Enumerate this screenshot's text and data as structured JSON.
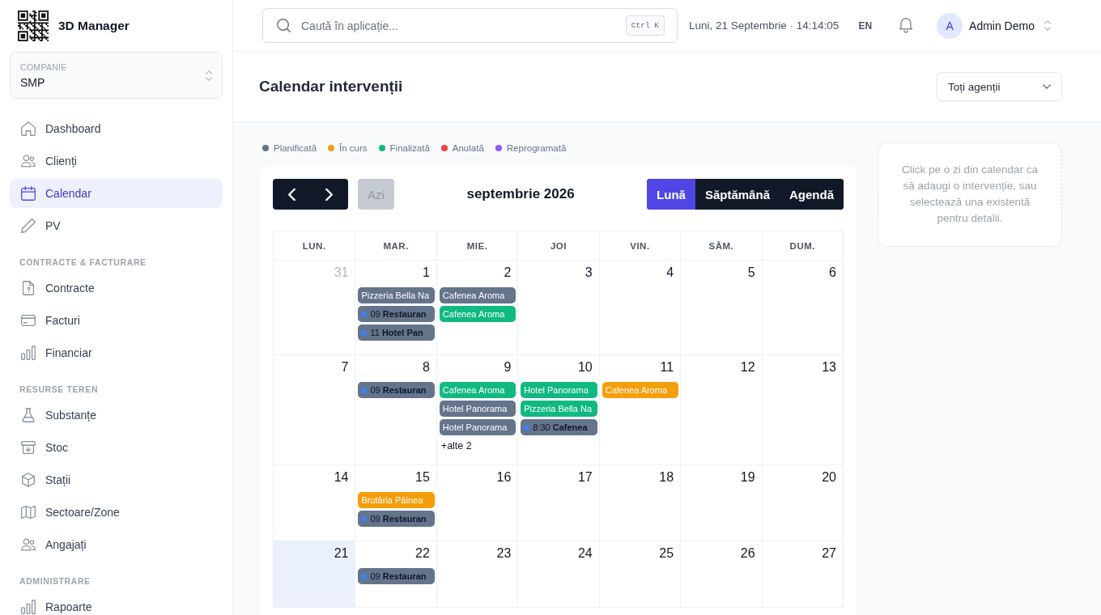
{
  "sidebar": {
    "brand": "3D Manager",
    "company": {
      "label": "COMPANIE",
      "value": "SMP"
    },
    "sections": [
      {
        "items": [
          {
            "label": "Dashboard",
            "selected": false
          },
          {
            "label": "Clienți",
            "selected": false
          },
          {
            "label": "Calendar",
            "selected": true
          },
          {
            "label": "PV",
            "selected": false
          }
        ]
      },
      {
        "heading": "CONTRACTE & FACTURARE",
        "items": [
          {
            "label": "Contracte",
            "selected": false
          },
          {
            "label": "Facturi",
            "selected": false
          },
          {
            "label": "Financiar",
            "selected": false
          }
        ]
      },
      {
        "heading": "RESURSE TEREN",
        "items": [
          {
            "label": "Substanțe",
            "selected": false
          },
          {
            "label": "Stoc",
            "selected": false
          },
          {
            "label": "Stații",
            "selected": false
          },
          {
            "label": "Sectoare/Zone",
            "selected": false
          },
          {
            "label": "Angajați",
            "selected": false
          }
        ]
      },
      {
        "heading": "ADMINISTRARE",
        "items": [
          {
            "label": "Rapoarte",
            "selected": false
          }
        ]
      }
    ]
  },
  "topbar": {
    "search": {
      "placeholder": "Caută în aplicație...",
      "shortcut": "Ctrl K"
    },
    "datetime": "Luni, 21 Septembrie · 14:14:05",
    "language": "EN",
    "user": {
      "initial": "A",
      "name": "Admin Demo"
    }
  },
  "page": {
    "title": "Calendar intervenții",
    "agent_filter": {
      "value": "Toți agenții"
    }
  },
  "legend": [
    {
      "label": "Planificată",
      "color": "#64748b"
    },
    {
      "label": "În curs",
      "color": "#f59e0b"
    },
    {
      "label": "Finalizată",
      "color": "#10b981"
    },
    {
      "label": "Anulată",
      "color": "#ef4444"
    },
    {
      "label": "Reprogramată",
      "color": "#8b5cf6"
    }
  ],
  "calendar": {
    "today_button": {
      "label": "Azi",
      "disabled": true
    },
    "title": "septembrie 2026",
    "views": [
      {
        "label": "Lună",
        "selected": true
      },
      {
        "label": "Săptămână",
        "selected": false
      },
      {
        "label": "Agendă",
        "selected": false
      }
    ],
    "weekdays": [
      "LUN.",
      "MAR.",
      "MIE.",
      "JOI",
      "VIN.",
      "SÂM.",
      "DUM."
    ],
    "weeks": [
      {
        "days": [
          {
            "day": "31",
            "outside": true,
            "today": false
          },
          {
            "day": "1",
            "outside": false,
            "today": false,
            "events": [
              {
                "kind": "allday",
                "label": "Pizzeria Bella Na",
                "color": "#64748b"
              },
              {
                "kind": "timed",
                "label": "09 **Restauran**",
                "color": "#64748b"
              },
              {
                "kind": "timed",
                "label": "11 **Hotel Pan**",
                "color": "#64748b"
              }
            ]
          },
          {
            "day": "2",
            "outside": false,
            "today": false,
            "events": [
              {
                "kind": "allday",
                "label": "Cafenea Aroma",
                "color": "#64748b"
              },
              {
                "kind": "allday",
                "label": "Cafenea Aroma",
                "color": "#10b981"
              }
            ]
          },
          {
            "day": "3",
            "outside": false,
            "today": false
          },
          {
            "day": "4",
            "outside": false,
            "today": false
          },
          {
            "day": "5",
            "outside": false,
            "today": false
          },
          {
            "day": "6",
            "outside": false,
            "today": false
          }
        ]
      },
      {
        "days": [
          {
            "day": "7",
            "outside": false,
            "today": false
          },
          {
            "day": "8",
            "outside": false,
            "today": false,
            "events": [
              {
                "kind": "timed",
                "label": "09 **Restauran**",
                "color": "#64748b"
              }
            ]
          },
          {
            "day": "9",
            "outside": false,
            "today": false,
            "events": [
              {
                "kind": "allday",
                "label": "Cafenea Aroma",
                "color": "#10b981"
              },
              {
                "kind": "allday",
                "label": "Hotel Panorama",
                "color": "#64748b"
              },
              {
                "kind": "allday",
                "label": "Hotel Panorama",
                "color": "#64748b"
              }
            ],
            "more": "+alte 2"
          },
          {
            "day": "10",
            "outside": false,
            "today": false,
            "events": [
              {
                "kind": "allday",
                "label": "Hotel Panorama",
                "color": "#10b981"
              },
              {
                "kind": "allday",
                "label": "Pizzeria Bella Na",
                "color": "#10b981"
              },
              {
                "kind": "timed",
                "label": "8:30 **Cafenea**",
                "color": "#64748b"
              }
            ]
          },
          {
            "day": "11",
            "outside": false,
            "today": false,
            "events": [
              {
                "kind": "allday",
                "label": "Cafenea Aroma",
                "color": "#f59e0b"
              }
            ]
          },
          {
            "day": "12",
            "outside": false,
            "today": false
          },
          {
            "day": "13",
            "outside": false,
            "today": false
          }
        ]
      },
      {
        "days": [
          {
            "day": "14",
            "outside": false,
            "today": false
          },
          {
            "day": "15",
            "outside": false,
            "today": false,
            "events": [
              {
                "kind": "allday",
                "label": "Brutăria Pâinea",
                "color": "#f59e0b"
              },
              {
                "kind": "timed",
                "label": "09 **Restauran**",
                "color": "#64748b"
              }
            ]
          },
          {
            "day": "16",
            "outside": false,
            "today": false
          },
          {
            "day": "17",
            "outside": false,
            "today": false
          },
          {
            "day": "18",
            "outside": false,
            "today": false
          },
          {
            "day": "19",
            "outside": false,
            "today": false
          },
          {
            "day": "20",
            "outside": false,
            "today": false
          }
        ]
      },
      {
        "days": [
          {
            "day": "21",
            "outside": false,
            "today": true
          },
          {
            "day": "22",
            "outside": false,
            "today": false,
            "events": [
              {
                "kind": "timed",
                "label": "09 **Restauran**",
                "color": "#64748b"
              }
            ]
          },
          {
            "day": "23",
            "outside": false,
            "today": false
          },
          {
            "day": "24",
            "outside": false,
            "today": false
          },
          {
            "day": "25",
            "outside": false,
            "today": false
          },
          {
            "day": "26",
            "outside": false,
            "today": false
          },
          {
            "day": "27",
            "outside": false,
            "today": false
          }
        ]
      }
    ]
  },
  "hint": "Click pe o zi din calendar ca să adaugi o intervenție, sau selectează una existentă pentru detalii."
}
